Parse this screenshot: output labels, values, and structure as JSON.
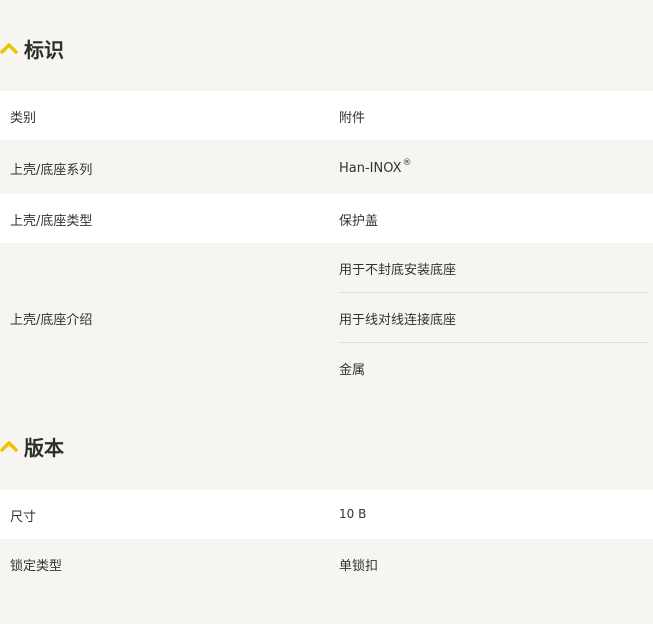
{
  "sections": {
    "identification": {
      "title": "标识",
      "rows": {
        "category": {
          "label": "类别",
          "value": "附件"
        },
        "series": {
          "label": "上壳/底座系列",
          "value": "Han-INOX",
          "mark": "®"
        },
        "type": {
          "label": "上壳/底座类型",
          "value": "保护盖"
        },
        "description": {
          "label": "上壳/底座介绍",
          "values": [
            "用于不封底安装底座",
            "用于线对线连接底座",
            "金属"
          ]
        }
      }
    },
    "version": {
      "title": "版本",
      "rows": {
        "size": {
          "label": "尺寸",
          "value": "10 B"
        },
        "lock_type": {
          "label": "锁定类型",
          "value": "单锁扣"
        }
      }
    }
  },
  "colors": {
    "accent": "#f2c200",
    "background": "#f6f5f2",
    "row_white": "#ffffff",
    "divider": "#dcdcdc"
  },
  "icons": {
    "section_toggle": "chevron-up-icon"
  }
}
